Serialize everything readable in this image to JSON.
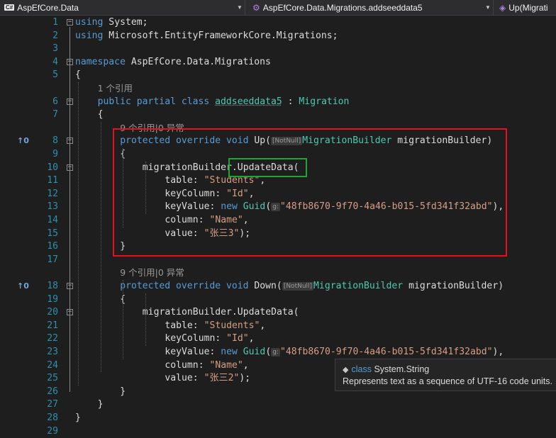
{
  "navbar": {
    "project_badge": "C#",
    "project": "AspEfCore.Data",
    "class_path": "AspEfCore.Data.Migrations.addseeddata5",
    "member": "Up(Migrati"
  },
  "lines": [
    {
      "n": "1",
      "fold": "minus",
      "tokens": [
        {
          "c": "k",
          "t": "using"
        },
        {
          "t": " System;"
        }
      ]
    },
    {
      "n": "2",
      "fold": "",
      "tokens": [
        {
          "c": "k",
          "t": "using"
        },
        {
          "t": " Microsoft.EntityFrameworkCore.Migrations;"
        }
      ]
    },
    {
      "n": "3",
      "fold": "",
      "tokens": []
    },
    {
      "n": "4",
      "fold": "minus",
      "tokens": [
        {
          "c": "k",
          "t": "namespace"
        },
        {
          "t": " AspEfCore.Data.Migrations"
        }
      ]
    },
    {
      "n": "5",
      "fold": "",
      "tokens": [
        {
          "t": "{"
        }
      ]
    },
    {
      "n": "",
      "fold": "",
      "lens": true,
      "indent": 4,
      "tokens": [
        {
          "c": "lens",
          "t": "1 个引用"
        }
      ]
    },
    {
      "n": "6",
      "fold": "minus",
      "indent": 4,
      "tokens": [
        {
          "c": "k",
          "t": "public partial class"
        },
        {
          "t": " "
        },
        {
          "c": "unused",
          "t": "addseeddata5"
        },
        {
          "t": " : "
        },
        {
          "c": "t",
          "t": "Migration"
        }
      ]
    },
    {
      "n": "7",
      "fold": "",
      "indent": 4,
      "tokens": [
        {
          "t": "{"
        }
      ]
    },
    {
      "n": "",
      "fold": "",
      "lens": true,
      "indent": 8,
      "tokens": [
        {
          "c": "lens",
          "t": "9 个引用|0 异常"
        }
      ]
    },
    {
      "n": "8",
      "fold": "minus",
      "ovr": "↑0",
      "indent": 8,
      "tokens": [
        {
          "c": "k",
          "t": "protected override void"
        },
        {
          "t": " Up("
        },
        {
          "c": "hint",
          "t": "[NotNull]"
        },
        {
          "c": "t",
          "t": "MigrationBuilder"
        },
        {
          "t": " migrationBuilder)"
        }
      ]
    },
    {
      "n": "9",
      "fold": "",
      "indent": 8,
      "tokens": [
        {
          "t": "{"
        }
      ]
    },
    {
      "n": "10",
      "fold": "minus",
      "indent": 12,
      "tokens": [
        {
          "t": "migrationBuilder.UpdateData("
        }
      ]
    },
    {
      "n": "11",
      "fold": "",
      "indent": 16,
      "tokens": [
        {
          "t": "table: "
        },
        {
          "c": "s",
          "t": "\"Students\""
        },
        {
          "t": ","
        }
      ]
    },
    {
      "n": "12",
      "fold": "",
      "indent": 16,
      "tokens": [
        {
          "t": "keyColumn: "
        },
        {
          "c": "s",
          "t": "\"Id\""
        },
        {
          "t": ","
        }
      ]
    },
    {
      "n": "13",
      "fold": "",
      "indent": 16,
      "tokens": [
        {
          "t": "keyValue: "
        },
        {
          "c": "k",
          "t": "new"
        },
        {
          "t": " "
        },
        {
          "c": "t",
          "t": "Guid"
        },
        {
          "t": "("
        },
        {
          "c": "hint",
          "t": "g:"
        },
        {
          "c": "s",
          "t": "\"48fb8670-9f70-4a46-b015-5fd341f32abd\""
        },
        {
          "t": "),"
        }
      ]
    },
    {
      "n": "14",
      "fold": "",
      "indent": 16,
      "tokens": [
        {
          "t": "column: "
        },
        {
          "c": "s",
          "t": "\"Name\""
        },
        {
          "t": ","
        }
      ]
    },
    {
      "n": "15",
      "fold": "",
      "indent": 16,
      "tokens": [
        {
          "t": "value: "
        },
        {
          "c": "s",
          "t": "\"张三3\""
        },
        {
          "t": ");"
        }
      ]
    },
    {
      "n": "16",
      "fold": "",
      "indent": 8,
      "tokens": [
        {
          "t": "}"
        }
      ]
    },
    {
      "n": "17",
      "fold": "",
      "tokens": []
    },
    {
      "n": "",
      "fold": "",
      "lens": true,
      "indent": 8,
      "tokens": [
        {
          "c": "lens",
          "t": "9 个引用|0 异常"
        }
      ]
    },
    {
      "n": "18",
      "fold": "minus",
      "ovr": "↑0",
      "indent": 8,
      "tokens": [
        {
          "c": "k",
          "t": "protected override void"
        },
        {
          "t": " Down("
        },
        {
          "c": "hint",
          "t": "[NotNull]"
        },
        {
          "c": "t",
          "t": "MigrationBuilder"
        },
        {
          "t": " migrationBuilder)"
        }
      ]
    },
    {
      "n": "19",
      "fold": "",
      "indent": 8,
      "tokens": [
        {
          "t": "{"
        }
      ]
    },
    {
      "n": "20",
      "fold": "minus",
      "indent": 12,
      "tokens": [
        {
          "t": "migrationBuilder.UpdateData("
        }
      ]
    },
    {
      "n": "21",
      "fold": "",
      "indent": 16,
      "tokens": [
        {
          "t": "table: "
        },
        {
          "c": "s",
          "t": "\"Students\""
        },
        {
          "t": ","
        }
      ]
    },
    {
      "n": "22",
      "fold": "",
      "indent": 16,
      "tokens": [
        {
          "t": "keyColumn: "
        },
        {
          "c": "s",
          "t": "\"Id\""
        },
        {
          "t": ","
        }
      ]
    },
    {
      "n": "23",
      "fold": "",
      "indent": 16,
      "tokens": [
        {
          "t": "keyValue: "
        },
        {
          "c": "k",
          "t": "new"
        },
        {
          "t": " "
        },
        {
          "c": "t",
          "t": "Guid"
        },
        {
          "t": "("
        },
        {
          "c": "hint",
          "t": "g:"
        },
        {
          "c": "s",
          "t": "\"48fb8670-9f70-4a46-b015-5fd341f32abd\""
        },
        {
          "t": "),"
        }
      ]
    },
    {
      "n": "24",
      "fold": "",
      "indent": 16,
      "tokens": [
        {
          "t": "column: "
        },
        {
          "c": "s",
          "t": "\"Name\""
        },
        {
          "t": ","
        }
      ]
    },
    {
      "n": "25",
      "fold": "",
      "indent": 16,
      "tokens": [
        {
          "t": "value: "
        },
        {
          "c": "s",
          "t": "\"张三2\""
        },
        {
          "t": ");"
        }
      ]
    },
    {
      "n": "26",
      "fold": "",
      "indent": 8,
      "tokens": [
        {
          "t": "}"
        }
      ]
    },
    {
      "n": "27",
      "fold": "",
      "indent": 4,
      "tokens": [
        {
          "t": "}"
        }
      ]
    },
    {
      "n": "28",
      "fold": "",
      "tokens": [
        {
          "t": "}"
        }
      ]
    },
    {
      "n": "29",
      "fold": "",
      "tokens": []
    }
  ],
  "tooltip": {
    "icon": "class-icon",
    "keyword": "class",
    "name": "System.String",
    "description": "Represents text as a sequence of UTF-16 code units."
  },
  "annotations": {
    "red_box_color": "#e81123",
    "green_box_color": "#21a336"
  }
}
